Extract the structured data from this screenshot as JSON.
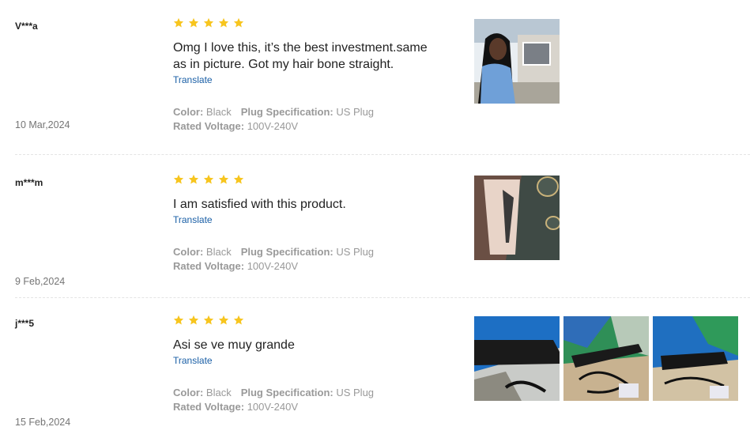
{
  "reviews": [
    {
      "user": "V***a",
      "date": "10 Mar,2024",
      "rating": 5,
      "text": "Omg I love this, it’s the best investment.same as in picture. Got my hair bone straight.",
      "translate": "Translate",
      "color_label": "Color:",
      "color_value": "Black",
      "plug_label": "Plug Specification:",
      "plug_value": "US Plug",
      "voltage_label": "Rated Voltage:",
      "voltage_value": "100V-240V",
      "photo_count": 1
    },
    {
      "user": "m***m",
      "date": "9 Feb,2024",
      "rating": 5,
      "text": "I am satisfied with this product.",
      "translate": "Translate",
      "color_label": "Color:",
      "color_value": "Black",
      "plug_label": "Plug Specification:",
      "plug_value": "US Plug",
      "voltage_label": "Rated Voltage:",
      "voltage_value": "100V-240V",
      "photo_count": 1
    },
    {
      "user": "j***5",
      "date": "15 Feb,2024",
      "rating": 5,
      "text": "Asi se ve muy grande",
      "translate": "Translate",
      "color_label": "Color:",
      "color_value": "Black",
      "plug_label": "Plug Specification:",
      "plug_value": "US Plug",
      "voltage_label": "Rated Voltage:",
      "voltage_value": "100V-240V",
      "photo_count": 3
    }
  ],
  "colors": {
    "star": "#f7c51e",
    "translate_link": "#1a5fa6",
    "meta_text": "#999999",
    "divider": "#e4e4e4"
  },
  "icons": {
    "star": "star-icon"
  }
}
